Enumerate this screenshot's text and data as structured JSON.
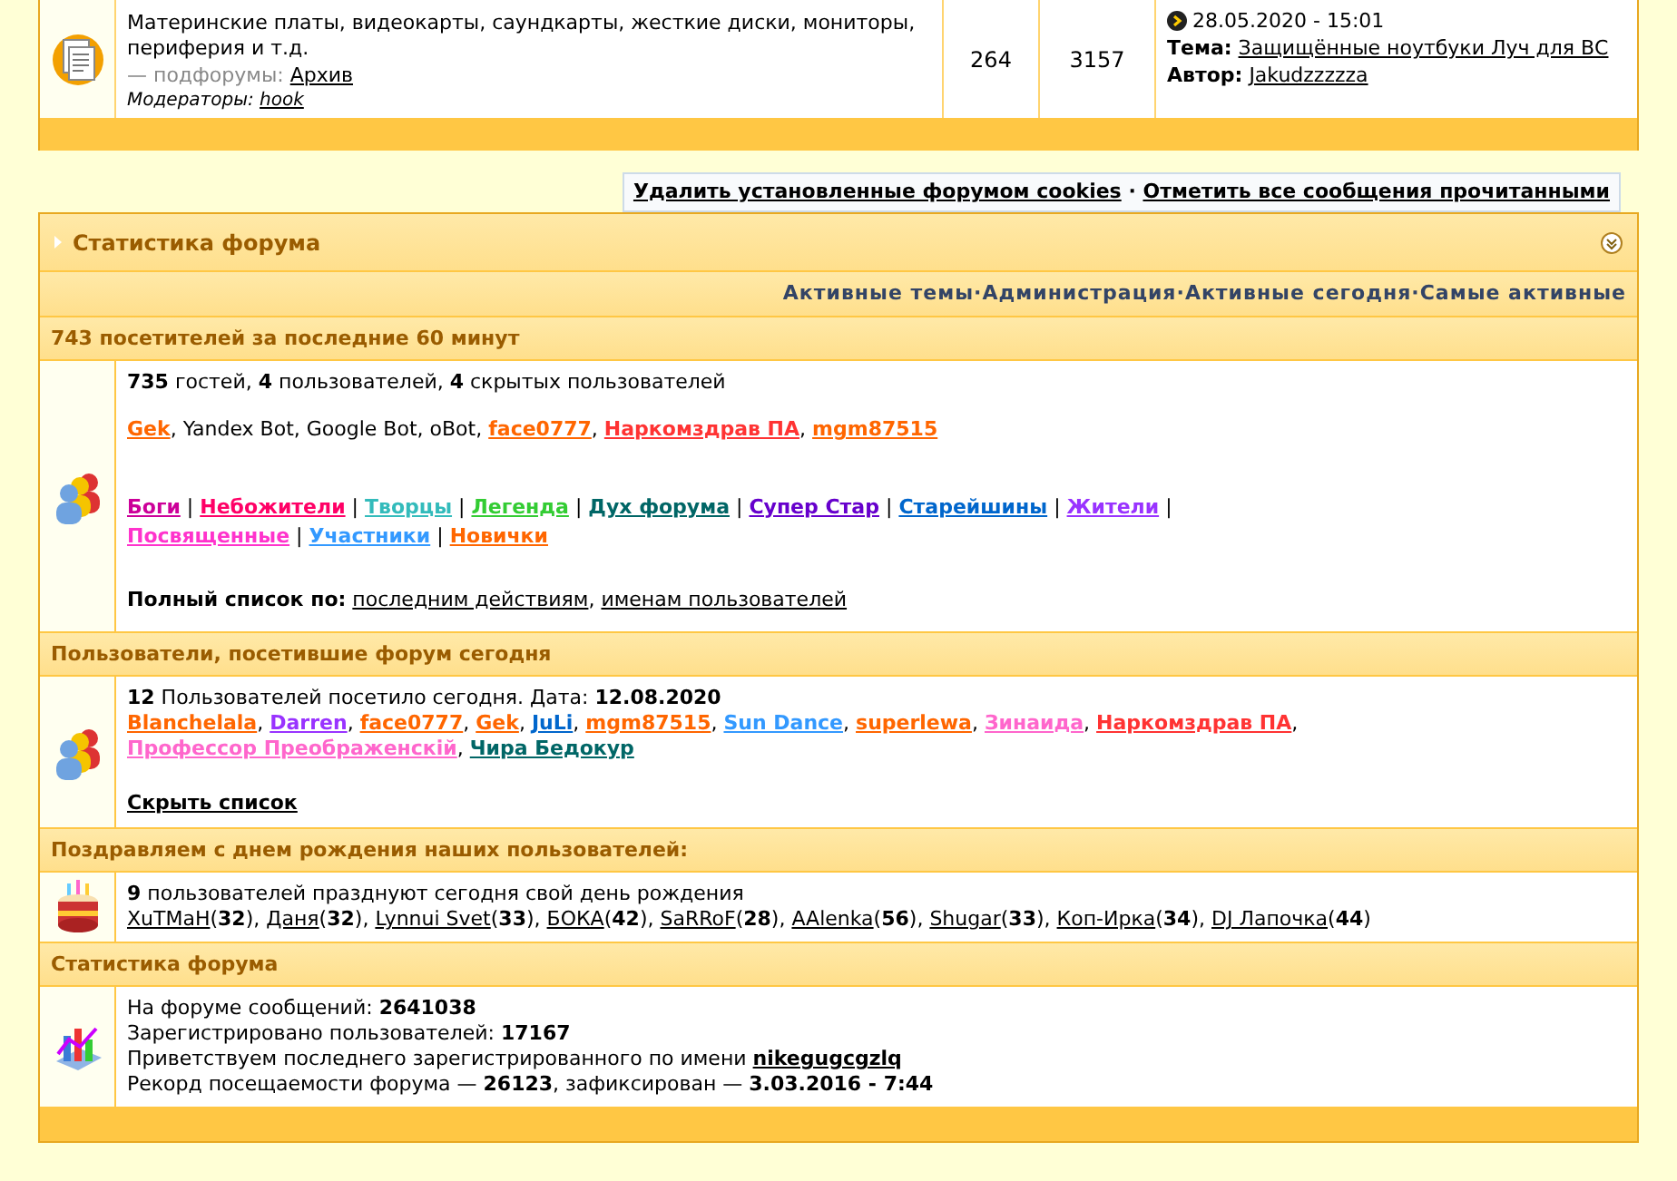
{
  "top_forum": {
    "description": "Материнские платы, видеокарты, саундкарты, жесткие диски, мониторы, периферия и т.д.",
    "subforums_label": "— подфорумы:",
    "subforum": "Архив",
    "moderators_label": "Модераторы:",
    "moderator": "hook",
    "topics": "264",
    "posts": "3157",
    "last_post": {
      "date": "28.05.2020 - 15:01",
      "topic_label": "Тема:",
      "topic": "Защищённые ноутбуки Луч для ВС",
      "author_label": "Автор:",
      "author": "Jakudzzzzza"
    }
  },
  "cookie_links": {
    "separator": "·",
    "links": [
      "Удалить установленные форумом cookies",
      "Отметить все сообщения прочитанными"
    ]
  },
  "stats": {
    "title": "Статистика форума",
    "nav_separator": "·",
    "nav_links": [
      "Активные темы",
      "Администрация",
      "Активные сегодня",
      "Самые активные"
    ],
    "sections": [
      {
        "kind": "online",
        "heading": "743 посетителей за последние 60 минут",
        "summary": "**735** гостей, **4** пользователей, **4** скрытых пользователей",
        "separator": ", ",
        "users": [
          {
            "kind": "user",
            "name": "Gek",
            "color": "#ff6600"
          },
          {
            "kind": "bot",
            "name": "Yandex Bot"
          },
          {
            "kind": "bot",
            "name": "Google Bot"
          },
          {
            "kind": "bot",
            "name": "oBot"
          },
          {
            "kind": "user",
            "name": "face0777",
            "color": "#ff6600"
          },
          {
            "kind": "user",
            "name": "Наркомздрав ПА",
            "color": "#ff3333"
          },
          {
            "kind": "user",
            "name": "mgm87515",
            "color": "#ff6600"
          }
        ],
        "group_separator": "|",
        "groups": [
          {
            "name": "Боги",
            "color": "#cc0099"
          },
          {
            "name": "Небожители",
            "color": "#ff0066"
          },
          {
            "name": "Творцы",
            "color": "#33bbbb"
          },
          {
            "name": "Легенда",
            "color": "#33cc33"
          },
          {
            "name": "Дух форума",
            "color": "#006666"
          },
          {
            "name": "Супер Стар",
            "color": "#6600cc"
          },
          {
            "name": "Старейшины",
            "color": "#0066cc"
          },
          {
            "name": "Жители",
            "color": "#9933ff"
          },
          {
            "name": "Посвященные",
            "color": "#ff33cc"
          },
          {
            "name": "Участники",
            "color": "#3399ff"
          },
          {
            "name": "Новички",
            "color": "#ff6600"
          }
        ],
        "full_list_label": "Полный список по:",
        "full_list_links": [
          "последним действиям",
          "именам пользователей"
        ]
      },
      {
        "kind": "today",
        "heading": "Пользователи, посетившие форум сегодня",
        "summary": "**12** Пользователей посетило сегодня. Дата: **12.08.2020**",
        "separator": ", ",
        "users": [
          {
            "kind": "user",
            "name": "Blanchelala",
            "color": "#ff6600"
          },
          {
            "kind": "user",
            "name": "Darren",
            "color": "#9933ff"
          },
          {
            "kind": "user",
            "name": "face0777",
            "color": "#ff6600"
          },
          {
            "kind": "user",
            "name": "Gek",
            "color": "#ff6600"
          },
          {
            "kind": "user",
            "name": "JuLi",
            "color": "#0066cc"
          },
          {
            "kind": "user",
            "name": "mgm87515",
            "color": "#ff6600"
          },
          {
            "kind": "user",
            "name": "Sun Dance",
            "color": "#3399ff"
          },
          {
            "kind": "user",
            "name": "superlewa",
            "color": "#ff6600"
          },
          {
            "kind": "user",
            "name": "Зинаида",
            "color": "#ff66cc"
          },
          {
            "kind": "user",
            "name": "Наркомздрав ПА",
            "color": "#ff3333"
          },
          {
            "kind": "user",
            "name": "Профессор Преображенскій",
            "color": "#ff66cc"
          },
          {
            "kind": "user",
            "name": "Чира Бедокур",
            "color": "#006666"
          }
        ],
        "hide_link": "Скрыть список"
      },
      {
        "kind": "birthdays",
        "heading": "Поздравляем с днем рождения наших пользователей:",
        "summary": "**9** пользователей празднуют сегодня свой день рождения",
        "separator": ", ",
        "people": [
          {
            "name": "XuTMaH",
            "age": "(**32**)"
          },
          {
            "name": "Даня",
            "age": "(**32**)"
          },
          {
            "name": "Lynnui Svet",
            "age": "(**33**)"
          },
          {
            "name": "БОКА",
            "age": "(**42**)"
          },
          {
            "name": "SaRRoF",
            "age": "(**28**)"
          },
          {
            "name": "AAlenka",
            "age": "(**56**)"
          },
          {
            "name": "Shugar",
            "age": "(**33**)"
          },
          {
            "name": "Коп-Ирка",
            "age": "(**34**)"
          },
          {
            "name": "DJ Лапочка",
            "age": "(**44**)"
          }
        ]
      },
      {
        "kind": "totals",
        "heading": "Статистика форума",
        "lines": [
          {
            "kind": "text",
            "text": "На форуме сообщений: **2641038**"
          },
          {
            "kind": "text",
            "text": "Зарегистрировано пользователей: **17167**"
          },
          {
            "kind": "newest",
            "text": "Приветствуем последнего зарегистрированного по имени",
            "link": "nikegugcgzlq"
          },
          {
            "kind": "text",
            "text": "Рекорд посещаемости форума — **26123**, зафиксирован — **3.03.2016 - 7:44**"
          }
        ]
      }
    ]
  }
}
